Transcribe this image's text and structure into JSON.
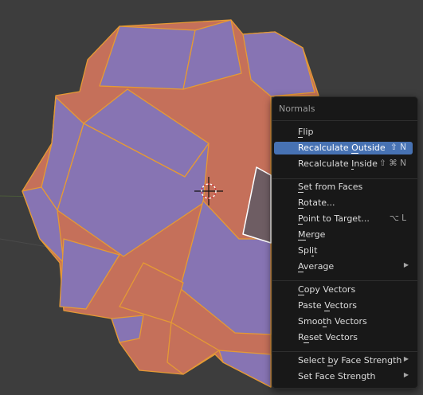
{
  "viewport": {
    "background": "#3d3d3d",
    "face_orange": "#c5705a",
    "face_purple": "#8774b3",
    "edge_color": "#e59a34",
    "selected_edge": "#ffffff"
  },
  "menu": {
    "title": "Normals",
    "items": [
      {
        "pre": "",
        "ul": "F",
        "post": "lip",
        "shortcut": "",
        "arrow": false,
        "active": false
      },
      {
        "pre": "Recalculate ",
        "ul": "O",
        "post": "utside",
        "shortcut": "⇧ N",
        "arrow": false,
        "active": true
      },
      {
        "pre": "Recalculate ",
        "ul": "I",
        "post": "nside",
        "shortcut": "⇧ ⌘ N",
        "arrow": false,
        "active": false
      },
      {
        "pre": "",
        "ul": "S",
        "post": "et from Faces",
        "shortcut": "",
        "arrow": false,
        "active": false
      },
      {
        "pre": "",
        "ul": "R",
        "post": "otate...",
        "shortcut": "",
        "arrow": false,
        "active": false
      },
      {
        "pre": "",
        "ul": "P",
        "post": "oint to Target...",
        "shortcut": "⌥ L",
        "arrow": false,
        "active": false
      },
      {
        "pre": "",
        "ul": "M",
        "post": "erge",
        "shortcut": "",
        "arrow": false,
        "active": false
      },
      {
        "pre": "Spl",
        "ul": "i",
        "post": "t",
        "shortcut": "",
        "arrow": false,
        "active": false
      },
      {
        "pre": "",
        "ul": "A",
        "post": "verage",
        "shortcut": "",
        "arrow": true,
        "active": false
      },
      {
        "pre": "",
        "ul": "C",
        "post": "opy Vectors",
        "shortcut": "",
        "arrow": false,
        "active": false
      },
      {
        "pre": "Paste ",
        "ul": "V",
        "post": "ectors",
        "shortcut": "",
        "arrow": false,
        "active": false
      },
      {
        "pre": "Smoo",
        "ul": "t",
        "post": "h Vectors",
        "shortcut": "",
        "arrow": false,
        "active": false
      },
      {
        "pre": "R",
        "ul": "e",
        "post": "set Vectors",
        "shortcut": "",
        "arrow": false,
        "active": false
      },
      {
        "pre": "Select ",
        "ul": "b",
        "post": "y Face Strength",
        "shortcut": "",
        "arrow": true,
        "active": false
      },
      {
        "pre": "Set Face Strength",
        "ul": "",
        "post": "",
        "shortcut": "",
        "arrow": true,
        "active": false
      }
    ]
  }
}
